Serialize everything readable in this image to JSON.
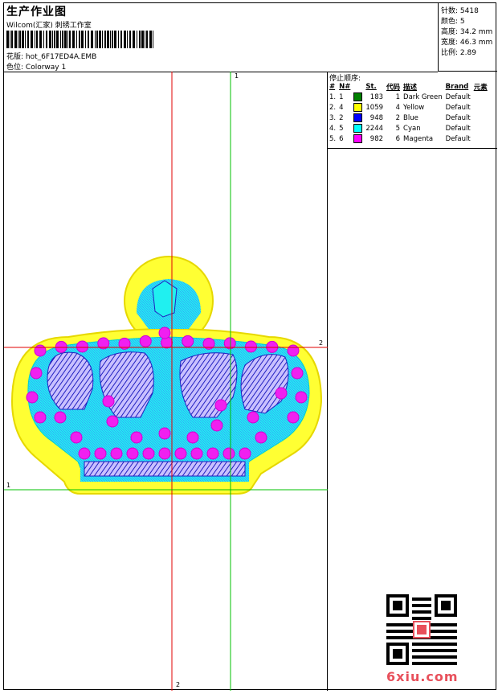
{
  "header": {
    "title": "生产作业图",
    "company": "Wilcom(汇家) 刺绣工作室",
    "design_label": "花版:",
    "design_value": "hot_6F17ED4A.EMB",
    "colorway_label": "色位:",
    "colorway_value": "Colorway 1"
  },
  "stats": {
    "stitches": "针数: 5418",
    "colors": "颜色: 5",
    "height": "高度: 34.2 mm",
    "width": "宽度: 46.3 mm",
    "scale": "比例: 2.89"
  },
  "sequence": {
    "title": "停止顺序:",
    "headers": [
      "#",
      "N#",
      "",
      "St.",
      "代码",
      "描述",
      "Brand",
      "元素"
    ],
    "rows": [
      {
        "num": "1.",
        "n": "1",
        "color": "#008000",
        "stitches": "183",
        "code": "1",
        "desc": "Dark Green",
        "brand": "Default"
      },
      {
        "num": "2.",
        "n": "4",
        "color": "#ffff00",
        "stitches": "1059",
        "code": "4",
        "desc": "Yellow",
        "brand": "Default"
      },
      {
        "num": "3.",
        "n": "2",
        "color": "#0000ff",
        "stitches": "948",
        "code": "2",
        "desc": "Blue",
        "brand": "Default"
      },
      {
        "num": "4.",
        "n": "5",
        "color": "#00ffff",
        "stitches": "2244",
        "code": "5",
        "desc": "Cyan",
        "brand": "Default"
      },
      {
        "num": "5.",
        "n": "6",
        "color": "#ff00ff",
        "stitches": "982",
        "code": "6",
        "desc": "Magenta",
        "brand": "Default"
      }
    ]
  },
  "guides": {
    "v_green": "1",
    "h_red": "2",
    "h_green": "1",
    "v_red": "2"
  },
  "watermark": "6xiu.com",
  "colors": {
    "red_guide": "#e00000",
    "green_guide": "#00c000",
    "yellow": "#ffff33",
    "cyan": "#20f0f0",
    "blue": "#2020c0",
    "magenta": "#f020f0"
  }
}
